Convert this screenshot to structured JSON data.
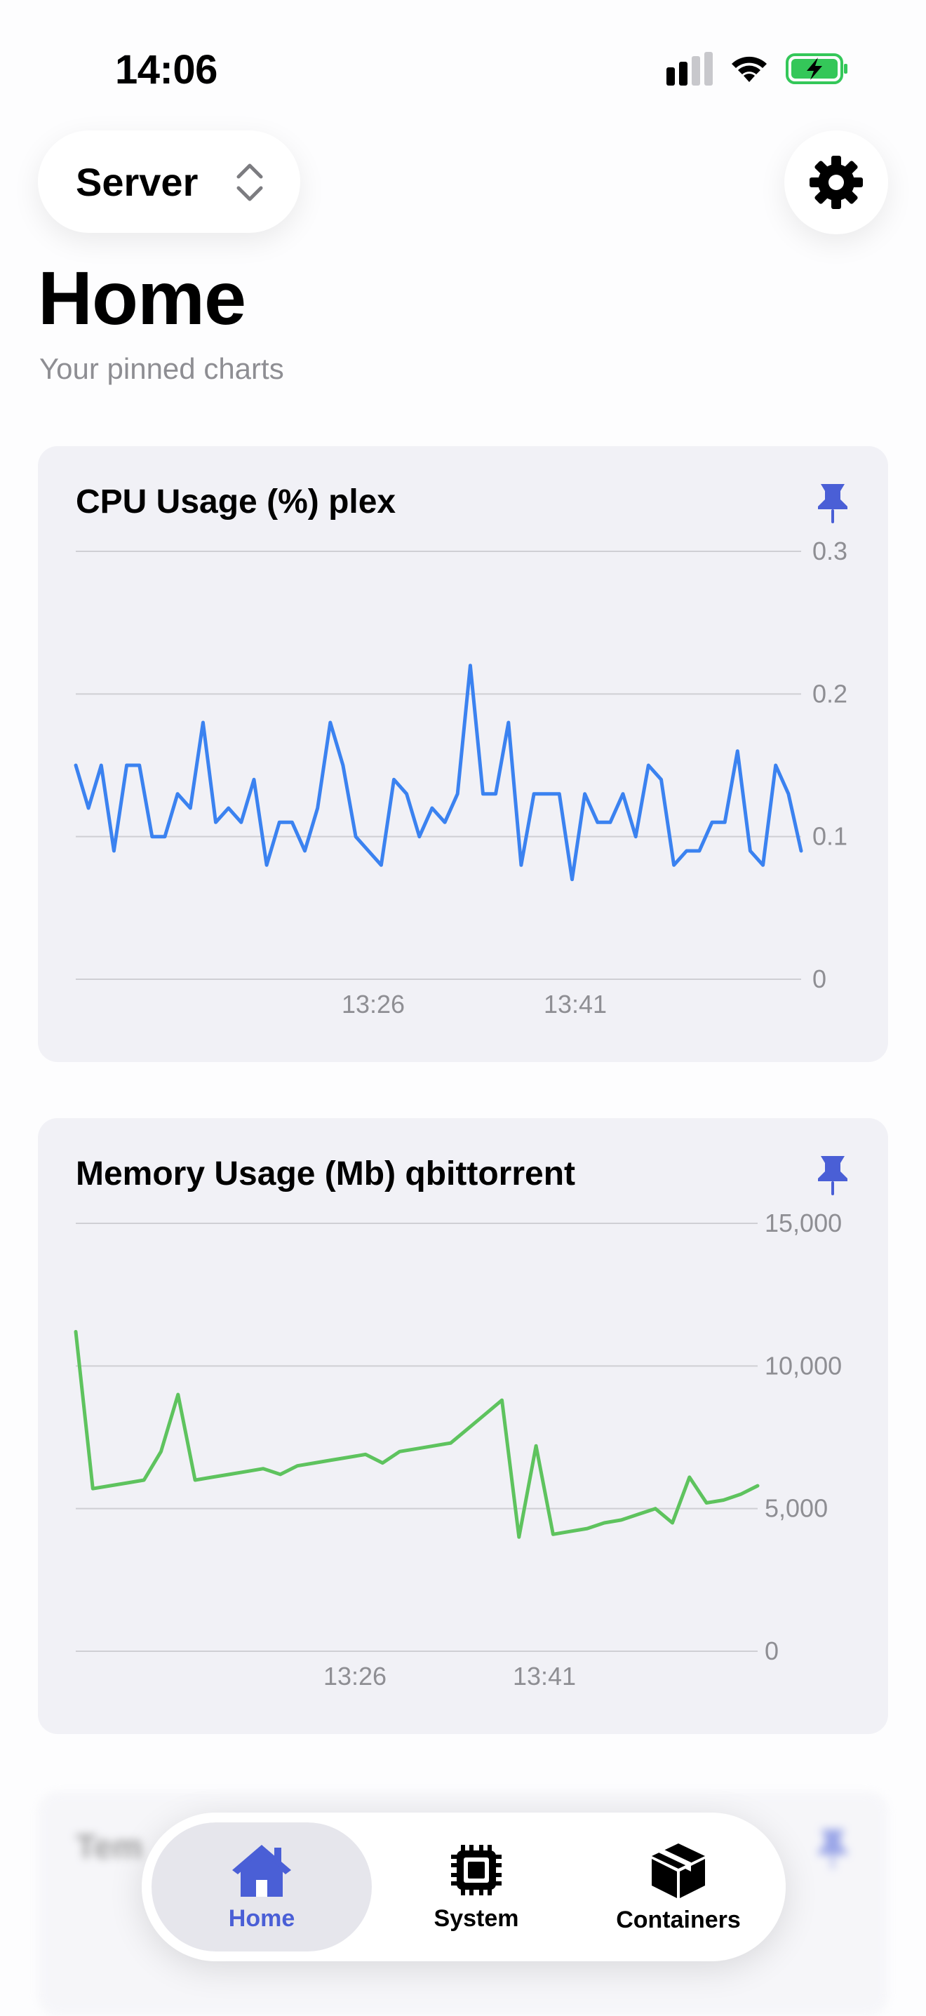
{
  "status_bar": {
    "time": "14:06"
  },
  "header": {
    "server_label": "Server"
  },
  "page": {
    "title": "Home",
    "subtitle": "Your pinned charts"
  },
  "colors": {
    "accent": "#4a5fd6",
    "cpu_line": "#3b82f0",
    "mem_line": "#5ec35e"
  },
  "cards": [
    {
      "title": "CPU Usage (%) plex",
      "icon": "pin-icon"
    },
    {
      "title": "Memory Usage (Mb) qbittorrent",
      "icon": "pin-icon"
    },
    {
      "title": "Tem",
      "icon": "pin-icon"
    }
  ],
  "chart_data": [
    {
      "type": "line",
      "title": "CPU Usage (%) plex",
      "ylim": [
        0,
        0.3
      ],
      "yticks": [
        "0.3",
        "0.2",
        "0.1",
        "0"
      ],
      "xtick_labels": [
        "13:26",
        "13:41"
      ],
      "series": [
        {
          "values": [
            0.15,
            0.12,
            0.15,
            0.09,
            0.15,
            0.15,
            0.1,
            0.1,
            0.13,
            0.12,
            0.18,
            0.11,
            0.12,
            0.11,
            0.14,
            0.08,
            0.11,
            0.11,
            0.09,
            0.12,
            0.18,
            0.15,
            0.1,
            0.09,
            0.08,
            0.14,
            0.13,
            0.1,
            0.12,
            0.11,
            0.13,
            0.22,
            0.13,
            0.13,
            0.18,
            0.08,
            0.13,
            0.13,
            0.13,
            0.07,
            0.13,
            0.11,
            0.11,
            0.13,
            0.1,
            0.15,
            0.14,
            0.08,
            0.09,
            0.09,
            0.11,
            0.11,
            0.16,
            0.09,
            0.08,
            0.15,
            0.13,
            0.09
          ]
        }
      ]
    },
    {
      "type": "line",
      "title": "Memory Usage (Mb) qbittorrent",
      "ylim": [
        0,
        15000
      ],
      "yticks": [
        "15,000",
        "10,000",
        "5,000",
        "0"
      ],
      "xtick_labels": [
        "13:26",
        "13:41"
      ],
      "series": [
        {
          "values": [
            11200,
            5700,
            5800,
            5900,
            6000,
            7000,
            9000,
            6000,
            6100,
            6200,
            6300,
            6400,
            6200,
            6500,
            6600,
            6700,
            6800,
            6900,
            6600,
            7000,
            7100,
            7200,
            7300,
            7800,
            8300,
            8800,
            4000,
            7200,
            4100,
            4200,
            4300,
            4500,
            4600,
            4800,
            5000,
            4500,
            6100,
            5200,
            5300,
            5500,
            5800
          ]
        }
      ]
    }
  ],
  "tabbar": {
    "tabs": [
      {
        "label": "Home",
        "icon": "house-icon",
        "active": true
      },
      {
        "label": "System",
        "icon": "cpu-chip-icon",
        "active": false
      },
      {
        "label": "Containers",
        "icon": "box-icon",
        "active": false
      }
    ]
  }
}
